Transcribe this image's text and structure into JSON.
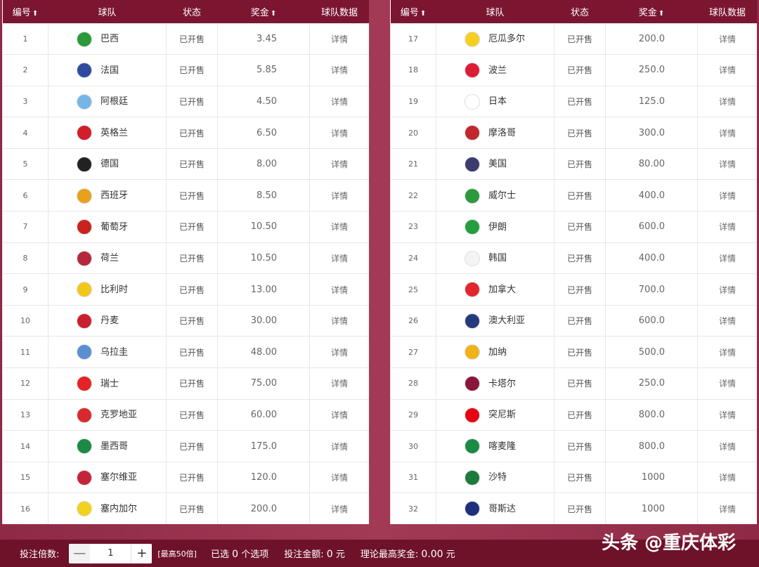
{
  "headers": {
    "num": "编号",
    "team": "球队",
    "status": "状态",
    "prize": "奖金",
    "data": "球队数据"
  },
  "sort_icon": "⬆",
  "left_rows": [
    {
      "num": "1",
      "team": "巴西",
      "status": "已开售",
      "prize": "3.45",
      "detail": "详情",
      "flag": "#2b9a3b"
    },
    {
      "num": "2",
      "team": "法国",
      "status": "已开售",
      "prize": "5.85",
      "detail": "详情",
      "flag": "#2e4aa0"
    },
    {
      "num": "3",
      "team": "阿根廷",
      "status": "已开售",
      "prize": "4.50",
      "detail": "详情",
      "flag": "#76b6e6"
    },
    {
      "num": "4",
      "team": "英格兰",
      "status": "已开售",
      "prize": "6.50",
      "detail": "详情",
      "flag": "#d21d2b"
    },
    {
      "num": "5",
      "team": "德国",
      "status": "已开售",
      "prize": "8.00",
      "detail": "详情",
      "flag": "#222222"
    },
    {
      "num": "6",
      "team": "西班牙",
      "status": "已开售",
      "prize": "8.50",
      "detail": "详情",
      "flag": "#e8a11a"
    },
    {
      "num": "7",
      "team": "葡萄牙",
      "status": "已开售",
      "prize": "10.50",
      "detail": "详情",
      "flag": "#c8231d"
    },
    {
      "num": "8",
      "team": "荷兰",
      "status": "已开售",
      "prize": "10.50",
      "detail": "详情",
      "flag": "#b5283b"
    },
    {
      "num": "9",
      "team": "比利时",
      "status": "已开售",
      "prize": "13.00",
      "detail": "详情",
      "flag": "#f3c61c"
    },
    {
      "num": "10",
      "team": "丹麦",
      "status": "已开售",
      "prize": "30.00",
      "detail": "详情",
      "flag": "#c9202f"
    },
    {
      "num": "11",
      "team": "乌拉圭",
      "status": "已开售",
      "prize": "48.00",
      "detail": "详情",
      "flag": "#5a8fd1"
    },
    {
      "num": "12",
      "team": "瑞士",
      "status": "已开售",
      "prize": "75.00",
      "detail": "详情",
      "flag": "#e52324"
    },
    {
      "num": "13",
      "team": "克罗地亚",
      "status": "已开售",
      "prize": "60.00",
      "detail": "详情",
      "flag": "#d72a2f"
    },
    {
      "num": "14",
      "team": "墨西哥",
      "status": "已开售",
      "prize": "175.0",
      "detail": "详情",
      "flag": "#1b8a45"
    },
    {
      "num": "15",
      "team": "塞尔维亚",
      "status": "已开售",
      "prize": "120.0",
      "detail": "详情",
      "flag": "#c4243b"
    },
    {
      "num": "16",
      "team": "塞内加尔",
      "status": "已开售",
      "prize": "200.0",
      "detail": "详情",
      "flag": "#f1d21c"
    }
  ],
  "right_rows": [
    {
      "num": "17",
      "team": "厄瓜多尔",
      "status": "已开售",
      "prize": "200.0",
      "detail": "详情",
      "flag": "#f5d022"
    },
    {
      "num": "18",
      "team": "波兰",
      "status": "已开售",
      "prize": "250.0",
      "detail": "详情",
      "flag": "#dc1e35"
    },
    {
      "num": "19",
      "team": "日本",
      "status": "已开售",
      "prize": "125.0",
      "detail": "详情",
      "flag": "#ffffff"
    },
    {
      "num": "20",
      "team": "摩洛哥",
      "status": "已开售",
      "prize": "300.0",
      "detail": "详情",
      "flag": "#c1272d"
    },
    {
      "num": "21",
      "team": "美国",
      "status": "已开售",
      "prize": "80.00",
      "detail": "详情",
      "flag": "#3c3b6e"
    },
    {
      "num": "22",
      "team": "威尔士",
      "status": "已开售",
      "prize": "400.0",
      "detail": "详情",
      "flag": "#2b9a3b"
    },
    {
      "num": "23",
      "team": "伊朗",
      "status": "已开售",
      "prize": "600.0",
      "detail": "详情",
      "flag": "#239f40"
    },
    {
      "num": "24",
      "team": "韩国",
      "status": "已开售",
      "prize": "400.0",
      "detail": "详情",
      "flag": "#f4f4f4"
    },
    {
      "num": "25",
      "team": "加拿大",
      "status": "已开售",
      "prize": "700.0",
      "detail": "详情",
      "flag": "#e3262d"
    },
    {
      "num": "26",
      "team": "澳大利亚",
      "status": "已开售",
      "prize": "600.0",
      "detail": "详情",
      "flag": "#253a7d"
    },
    {
      "num": "27",
      "team": "加纳",
      "status": "已开售",
      "prize": "500.0",
      "detail": "详情",
      "flag": "#f2b21c"
    },
    {
      "num": "28",
      "team": "卡塔尔",
      "status": "已开售",
      "prize": "250.0",
      "detail": "详情",
      "flag": "#8a1538"
    },
    {
      "num": "29",
      "team": "突尼斯",
      "status": "已开售",
      "prize": "800.0",
      "detail": "详情",
      "flag": "#e70013"
    },
    {
      "num": "30",
      "team": "喀麦隆",
      "status": "已开售",
      "prize": "800.0",
      "detail": "详情",
      "flag": "#1b8a45"
    },
    {
      "num": "31",
      "team": "沙特",
      "status": "已开售",
      "prize": "1000",
      "detail": "详情",
      "flag": "#1e7a3a"
    },
    {
      "num": "32",
      "team": "哥斯达",
      "status": "已开售",
      "prize": "1000",
      "detail": "详情",
      "flag": "#1e2f7c"
    }
  ],
  "footer": {
    "multiplier_label": "投注倍数:",
    "minus": "—",
    "multiplier_value": "1",
    "plus": "+",
    "max_hint": "[最高50倍]",
    "selected_prefix": "已选",
    "selected_count": "0",
    "selected_suffix": "个选项",
    "amount_label": "投注金额:",
    "amount_value": "0",
    "amount_unit": "元",
    "max_prize_label": "理论最高奖金:",
    "max_prize_value": "0.00",
    "max_prize_unit": "元"
  },
  "watermark": "头条 @重庆体彩"
}
